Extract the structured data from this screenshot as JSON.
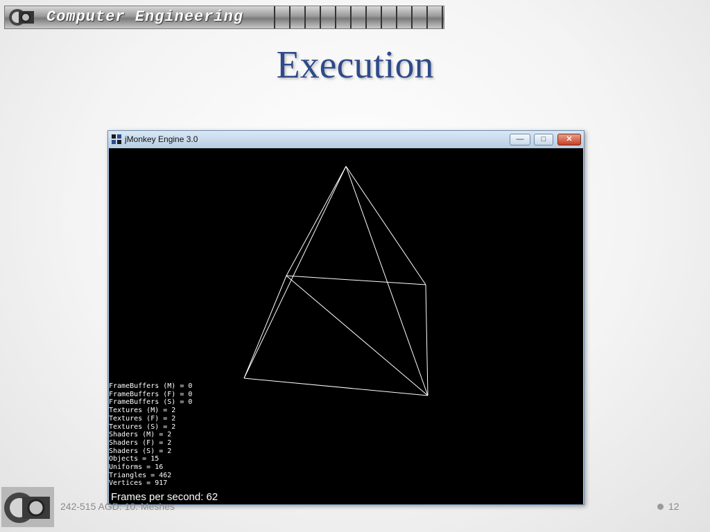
{
  "header": {
    "banner_title": "Computer Engineering"
  },
  "slide": {
    "title": "Execution"
  },
  "window": {
    "title": "jMonkey Engine 3.0",
    "controls": {
      "minimize": "—",
      "maximize": "□",
      "close": "✕"
    },
    "stats": [
      "FrameBuffers (M) = 0",
      "FrameBuffers (F) = 0",
      "FrameBuffers (S) = 0",
      "Textures (M) = 2",
      "Textures (F) = 2",
      "Textures (S) = 2",
      "Shaders (M) = 2",
      "Shaders (F) = 2",
      "Shaders (S) = 2",
      "Objects = 15",
      "Uniforms = 16",
      "Triangles = 462",
      "Vertices = 917"
    ],
    "fps": "Frames per second: 62"
  },
  "footer": {
    "text": "242-515 AGD: 10. Meshes",
    "page": "12"
  },
  "icons": {
    "banner_logo": "gear-logo-icon",
    "app_icon": "jmonkey-app-icon",
    "footer_logo": "gear-logo-icon"
  },
  "colors": {
    "title": "#2e4a8a",
    "viewport_bg": "#000000",
    "wireframe": "#ffffff"
  }
}
